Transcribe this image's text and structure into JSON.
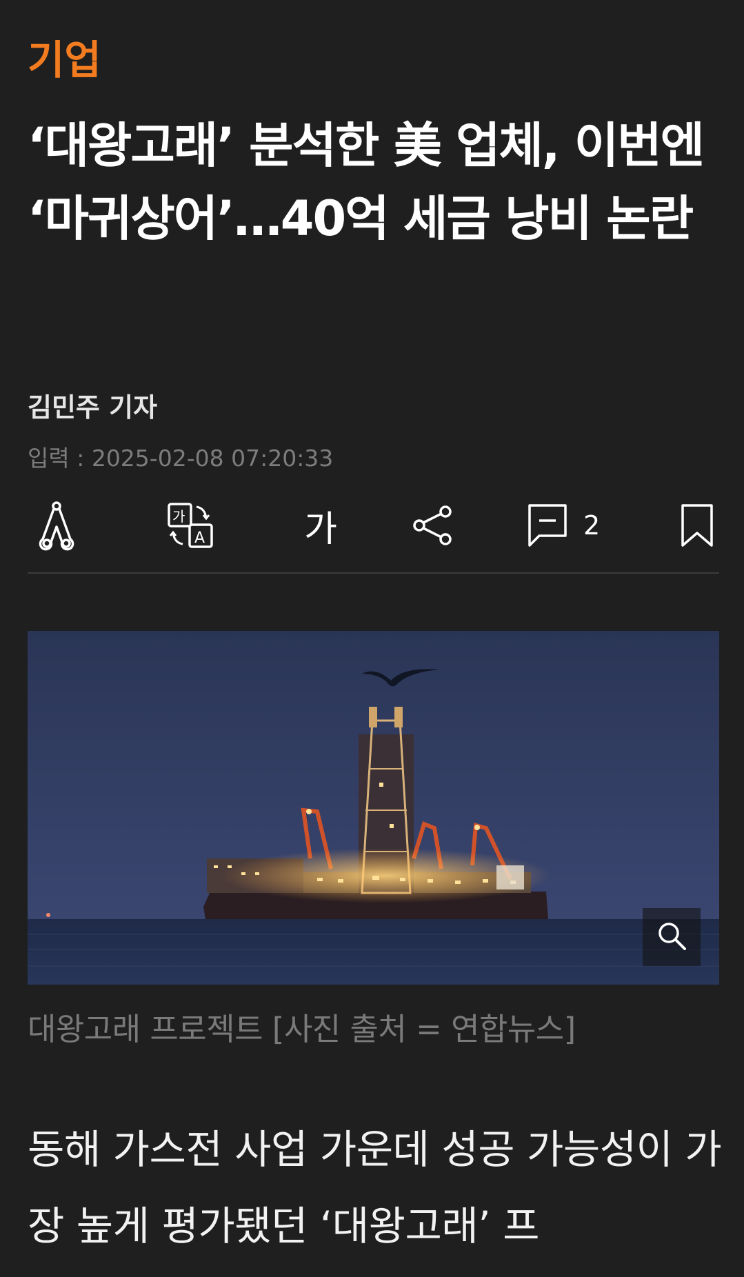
{
  "article": {
    "category": "기업",
    "headline": "‘대왕고래’ 분석한 美 업체, 이번엔 ‘마귀상어’…40억 세금 낭비 논란",
    "reporter": "김민주 기자",
    "published": "입력 : 2025-02-08 07:20:33",
    "photo_caption": "대왕고래 프로젝트 [사진 출처 = 연합뉴스]",
    "body_first": "동해 가스전 사업 가운데 성공 가능성이 가장 높게 평가됐던 ‘대왕고래’ 프"
  },
  "toolbar": {
    "text_size_label": "가",
    "comment_count": "2",
    "icons": [
      "ai-summary-icon",
      "translate-icon",
      "text-size-icon",
      "share-icon",
      "comment-icon",
      "bookmark-icon"
    ]
  },
  "colors": {
    "background": "#1f1f1f",
    "category": "#f47c20",
    "headline": "#ffffff",
    "meta": "#7d7d7d",
    "divider": "#3c3c3c"
  }
}
